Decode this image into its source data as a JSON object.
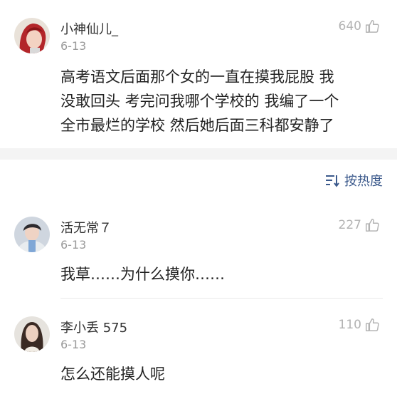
{
  "main_comment": {
    "username": "小神仙儿_",
    "date": "6-13",
    "likes": "640",
    "lines": [
      "高考语文后面那个女的一直在摸我屁股 我",
      "没敢回头 考完问我哪个学校的 我编了一个",
      "全市最烂的学校 然后她后面三科都安静了"
    ]
  },
  "sort": {
    "label": "按热度"
  },
  "replies": [
    {
      "username": "活无常７",
      "date": "6-13",
      "likes": "227",
      "text": "我草……为什么摸你……"
    },
    {
      "username": "李小丢 575",
      "date": "6-13",
      "likes": "110",
      "text": "怎么还能摸人呢"
    }
  ],
  "colors": {
    "accent": "#3c5a8c",
    "muted": "#9a9a9a"
  }
}
